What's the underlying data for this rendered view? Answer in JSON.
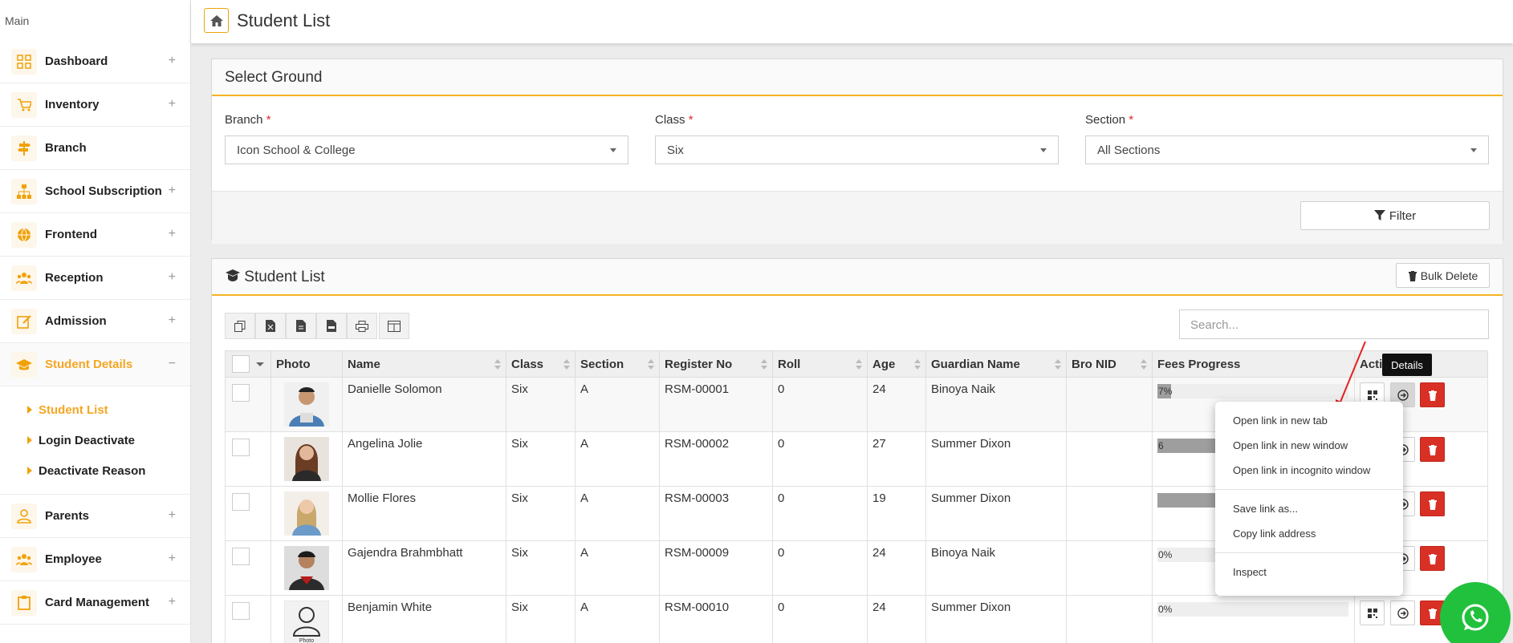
{
  "sidebar": {
    "main_label": "Main",
    "items": [
      {
        "label": "Dashboard",
        "icon": "grid-icon",
        "expand": "+"
      },
      {
        "label": "Inventory",
        "icon": "cart-icon",
        "expand": "+"
      },
      {
        "label": "Branch",
        "icon": "signpost-icon",
        "expand": ""
      },
      {
        "label": "School Subscription",
        "icon": "sitemap-icon",
        "expand": "+"
      },
      {
        "label": "Frontend",
        "icon": "globe-icon",
        "expand": "+"
      },
      {
        "label": "Reception",
        "icon": "users-icon",
        "expand": "+"
      },
      {
        "label": "Admission",
        "icon": "edit-icon",
        "expand": "+"
      },
      {
        "label": "Student Details",
        "icon": "graduation-cap-icon",
        "expand": "−"
      }
    ],
    "sub_items": [
      {
        "label": "Student List"
      },
      {
        "label": "Login Deactivate"
      },
      {
        "label": "Deactivate Reason"
      }
    ],
    "items2": [
      {
        "label": "Parents",
        "icon": "user-icon",
        "expand": "+"
      },
      {
        "label": "Employee",
        "icon": "users-icon",
        "expand": "+"
      },
      {
        "label": "Card Management",
        "icon": "clipboard-icon",
        "expand": "+"
      }
    ]
  },
  "header": {
    "title": "Student List"
  },
  "select_ground": {
    "title": "Select Ground",
    "branch": {
      "label": "Branch",
      "value": "Icon School & College"
    },
    "class": {
      "label": "Class",
      "value": "Six"
    },
    "section": {
      "label": "Section",
      "value": "All Sections"
    },
    "required_mark": "*",
    "filter_label": "Filter"
  },
  "student_list": {
    "title": "Student List",
    "bulk_delete": "Bulk Delete",
    "search_placeholder": "Search...",
    "columns": [
      "Photo",
      "Name",
      "Class",
      "Section",
      "Register No",
      "Roll",
      "Age",
      "Guardian Name",
      "Bro NID",
      "Fees Progress",
      "Acti"
    ],
    "rows": [
      {
        "name": "Danielle Solomon",
        "class": "Six",
        "section": "A",
        "register": "RSM-00001",
        "roll": "0",
        "age": "24",
        "guardian": "Binoya Naik",
        "bro_nid": "",
        "fees_text": "7%",
        "fees_fraction": 0.07
      },
      {
        "name": "Angelina Jolie",
        "class": "Six",
        "section": "A",
        "register": "RSM-00002",
        "roll": "0",
        "age": "27",
        "guardian": "Summer Dixon",
        "bro_nid": "",
        "fees_text": "6",
        "fees_fraction": 0.6
      },
      {
        "name": "Mollie Flores",
        "class": "Six",
        "section": "A",
        "register": "RSM-00003",
        "roll": "0",
        "age": "19",
        "guardian": "Summer Dixon",
        "bro_nid": "",
        "fees_text": "",
        "fees_fraction": 0.4
      },
      {
        "name": "Gajendra Brahmbhatt",
        "class": "Six",
        "section": "A",
        "register": "RSM-00009",
        "roll": "0",
        "age": "24",
        "guardian": "Binoya Naik",
        "bro_nid": "",
        "fees_text": "0%",
        "fees_fraction": 0
      },
      {
        "name": "Benjamin White",
        "class": "Six",
        "section": "A",
        "register": "RSM-00010",
        "roll": "0",
        "age": "24",
        "guardian": "Summer Dixon",
        "bro_nid": "",
        "fees_text": "0%",
        "fees_fraction": 0
      }
    ]
  },
  "placeholder_photo_text": "Photo",
  "tooltip": "Details",
  "context_menu": {
    "group1": [
      "Open link in new tab",
      "Open link in new window",
      "Open link in incognito window"
    ],
    "group2": [
      "Save link as...",
      "Copy link address"
    ],
    "group3": [
      "Inspect"
    ]
  },
  "colors": {
    "accent": "#f5a623",
    "danger": "#d93025",
    "whatsapp": "#22c13d"
  }
}
